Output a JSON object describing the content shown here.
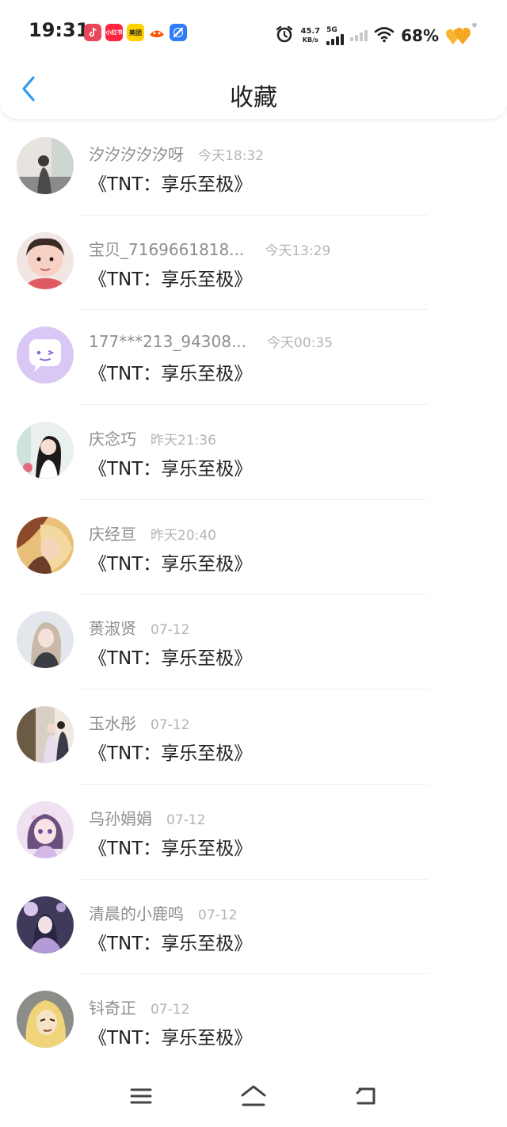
{
  "status_bar": {
    "time": "19:31",
    "notification_icons": [
      "douyin-icon",
      "xiaohongshu-icon",
      "meituan-icon",
      "taobao-icon",
      "browser-icon"
    ],
    "xhs_label": "小红书",
    "meituan_label": "美团",
    "net_speed": "45.7",
    "net_speed_unit": "KB/s",
    "network_type": "5G",
    "battery": "68%"
  },
  "header": {
    "title": "收藏",
    "back_icon": "chevron-left-icon",
    "accent_color": "#2f9bf0"
  },
  "items": [
    {
      "name": "汐汐汐汐汐呀",
      "time": "今天18:32",
      "work": "《TNT：享乐至极》"
    },
    {
      "name": "宝贝_7169661818...",
      "time": "今天13:29",
      "work": "《TNT：享乐至极》"
    },
    {
      "name": "177***213_94308...",
      "time": "今天00:35",
      "work": "《TNT：享乐至极》"
    },
    {
      "name": "庆念巧",
      "time": "昨天21:36",
      "work": "《TNT：享乐至极》"
    },
    {
      "name": "庆经亘",
      "time": "昨天20:40",
      "work": "《TNT：享乐至极》"
    },
    {
      "name": "蒉淑贤",
      "time": "07-12",
      "work": "《TNT：享乐至极》"
    },
    {
      "name": "玉水彤",
      "time": "07-12",
      "work": "《TNT：享乐至极》"
    },
    {
      "name": "乌孙娟娟",
      "time": "07-12",
      "work": "《TNT：享乐至极》"
    },
    {
      "name": "清晨的小鹿鸣",
      "time": "07-12",
      "work": "《TNT：享乐至极》"
    },
    {
      "name": "钭奇正",
      "time": "07-12",
      "work": "《TNT：享乐至极》"
    }
  ],
  "navbar": {
    "icons": [
      "menu-icon",
      "home-icon",
      "back-icon"
    ]
  }
}
